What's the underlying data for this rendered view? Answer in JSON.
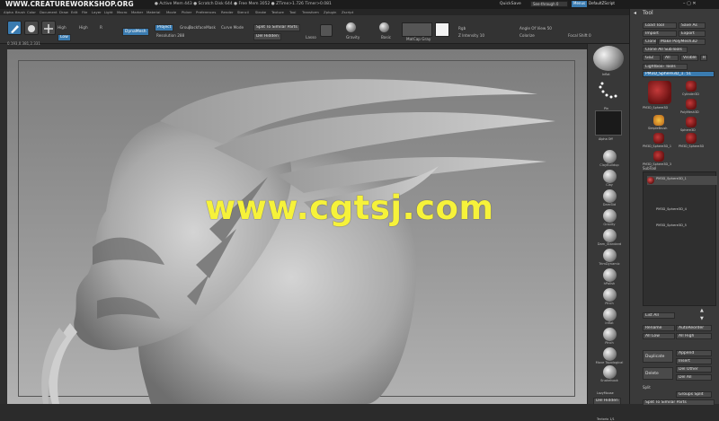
{
  "title_bar": {
    "brand": "WWW.CREATUREWORKSHOP.ORG",
    "status": "● Active Mem 443 ● Scratch Disk 644 ● Free Mem 3052 ● ZTime>1.726 Timer>0.081",
    "quicksave": "QuickSave",
    "see_through": "See-through 0",
    "menus": "Menus",
    "default_script": "DefaultZScript"
  },
  "menubar": [
    "Alpha",
    "Brush",
    "Color",
    "Document",
    "Draw",
    "Edit",
    "File",
    "Layer",
    "Light",
    "Macro",
    "Marker",
    "Material",
    "Movie",
    "Picker",
    "Preferences",
    "Render",
    "Stencil",
    "Stroke",
    "Texture",
    "Tool",
    "Transform",
    "Zplugin",
    "Zscript"
  ],
  "shelf": {
    "edit_label": "Edit",
    "high": "High",
    "high2": "High",
    "low": "Low",
    "sub_r": "R",
    "dynamesh": "DynaMesh",
    "project": "Project",
    "group": "Group",
    "backface_mask": "BackfaceMask",
    "curve_mode": "Curve Mode",
    "resolution": "Resolution 288",
    "split_to_similar": "Split To Similar Parts",
    "del_hidden": "Del Hidden",
    "lasso": "Lasso",
    "gravity": "Gravity",
    "basic": "Basic",
    "matcap_gray": "MatCap Gray",
    "rgb": "Rgb",
    "z_intensity": "Z Intensity 10",
    "colorize": "Colorize",
    "angle_of_view": "Angle Of View 50",
    "focal_shift": "Focal Shift 0"
  },
  "coord": "0.193,0.381,2.331",
  "watermark": "www.cgtsj.com",
  "right_shelf": [
    "Inflat",
    "Pinch",
    "Move Topological",
    "Snakehook",
    "LazyMouse",
    "Del Hidden",
    "Tectorio 1/1"
  ],
  "right_shelf_top": [
    "Inflat",
    "Pin",
    "Alpha Off",
    "ClayBuildup",
    "Clay",
    "DamStd",
    "Gravity",
    "Dam_Standard",
    "TrimDynamic",
    "hPolish",
    "Pinch"
  ],
  "tool_panel": {
    "title": "Tool",
    "load_tool": "Load Tool",
    "save_as": "Save As",
    "import": "Import",
    "export": "Export",
    "clone": "Clone",
    "make_polymesh": "Make PolyMesh3D",
    "clone_all": "Clone All SubTools",
    "goz": "GoZ",
    "all": "All",
    "visible": "Visible",
    "r": "R",
    "lightbox_tools": "Lightbox› Tools",
    "current_tool": "PM3D_Sphere3D_1. 51",
    "thumbs": [
      "PM3D_Sphere3D",
      "Cylinder3D",
      "PolyMesh3D",
      "SimpleBrush",
      "Sphere3D",
      "PM3D_Sphere3D_1",
      "PM3D_Sphere3D",
      "PM3D_Sphere3D_3"
    ],
    "subtool_header": "SubTool",
    "subtools": [
      "PM3D_Sphere3D_1",
      "PM3D_Sphere3D_4",
      "PM3D_Sphere3D_5"
    ],
    "list_all": "List All",
    "rename": "Rename",
    "auto_reorder": "AutoReorder",
    "all_low": "All Low",
    "all_high": "All High",
    "duplicate": "Duplicate",
    "append": "Append",
    "insert": "Insert",
    "delete": "Delete",
    "del_other": "Del Other",
    "del_all": "Del All",
    "split": "Split",
    "groups_split": "Groups Split",
    "split_similar": "Split To Similar Parts"
  },
  "colors": {
    "accent": "#3a7bb0",
    "watermark": "#f6f23a",
    "canvas": "#8e8e8e"
  }
}
